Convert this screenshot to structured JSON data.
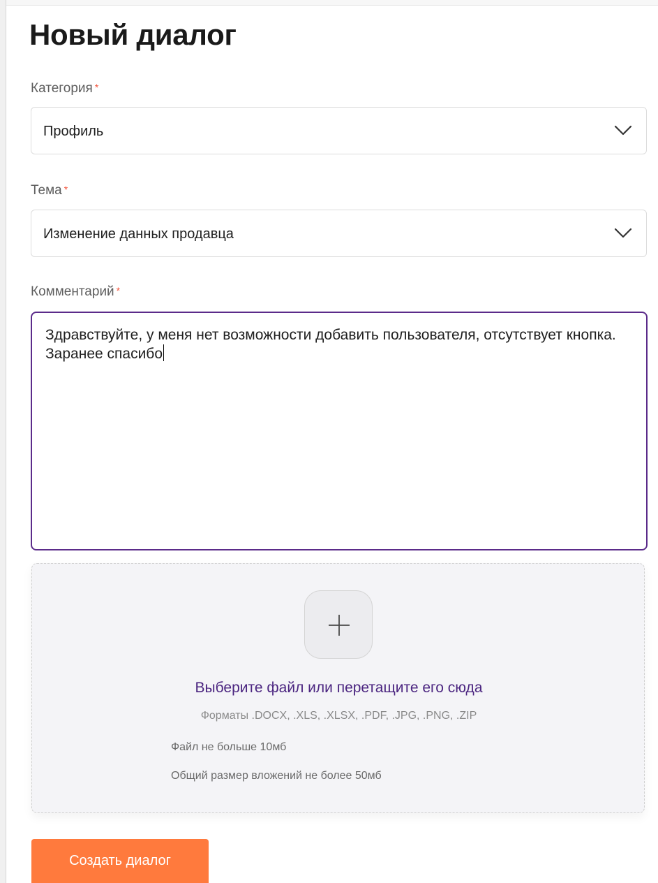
{
  "title": "Новый диалог",
  "required_mark": "*",
  "category": {
    "label": "Категория",
    "value": "Профиль"
  },
  "topic": {
    "label": "Тема",
    "value": "Изменение данных продавца"
  },
  "comment": {
    "label": "Комментарий",
    "value": "Здравствуйте, у меня нет возможности добавить пользователя, отсутствует кнопка. Заранее спасибо"
  },
  "upload": {
    "choose_text": "Выберите файл или перетащите его сюда",
    "formats": "Форматы .DOCX, .XLS, .XLSX, .PDF, .JPG, .PNG, .ZIP",
    "file_limit": "Файл не больше 10мб",
    "total_limit": "Общий размер вложений не более 50мб"
  },
  "submit_label": "Создать диалог",
  "colors": {
    "accent_purple": "#5b2b8a",
    "link_purple": "#4b2580",
    "required_red": "#f2533b",
    "button_orange": "#ff7a3d"
  }
}
